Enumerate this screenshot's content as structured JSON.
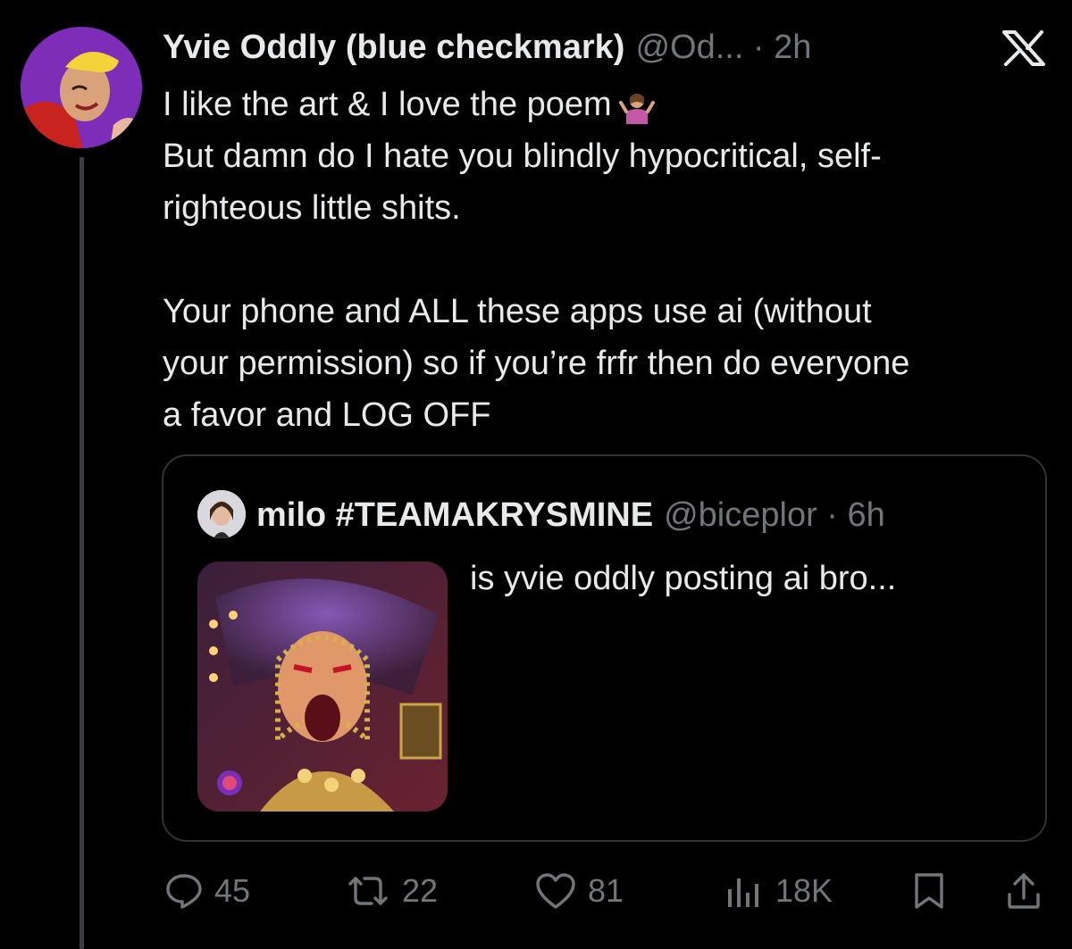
{
  "post": {
    "display_name": "Yvie Oddly (blue checkmark)",
    "handle_time": "@Od... · 2h",
    "lines": [
      "I like the art & I love the poem",
      "But damn do I hate you blindly hypocritical, self-",
      "righteous little shits.",
      "Your phone and ALL these apps use ai (without",
      "your permission) so if you’re frfr then do everyone",
      "a favor and LOG OFF"
    ],
    "emoji": "person-shrugging-emoji"
  },
  "quoted": {
    "display_name": "milo #TEAMAKRYSMINE",
    "handle_time": "@biceplor · 6h",
    "text": "is yvie oddly posting ai bro..."
  },
  "actions": {
    "replies": "45",
    "reposts": "22",
    "likes": "81",
    "views": "18K"
  },
  "icons": [
    "x-logo-icon",
    "reply-icon",
    "repost-icon",
    "like-icon",
    "views-icon",
    "bookmark-icon",
    "share-icon"
  ],
  "colors": {
    "background": "#000000",
    "text": "#e7e9ea",
    "muted": "#71767b",
    "border": "#2f3336"
  }
}
